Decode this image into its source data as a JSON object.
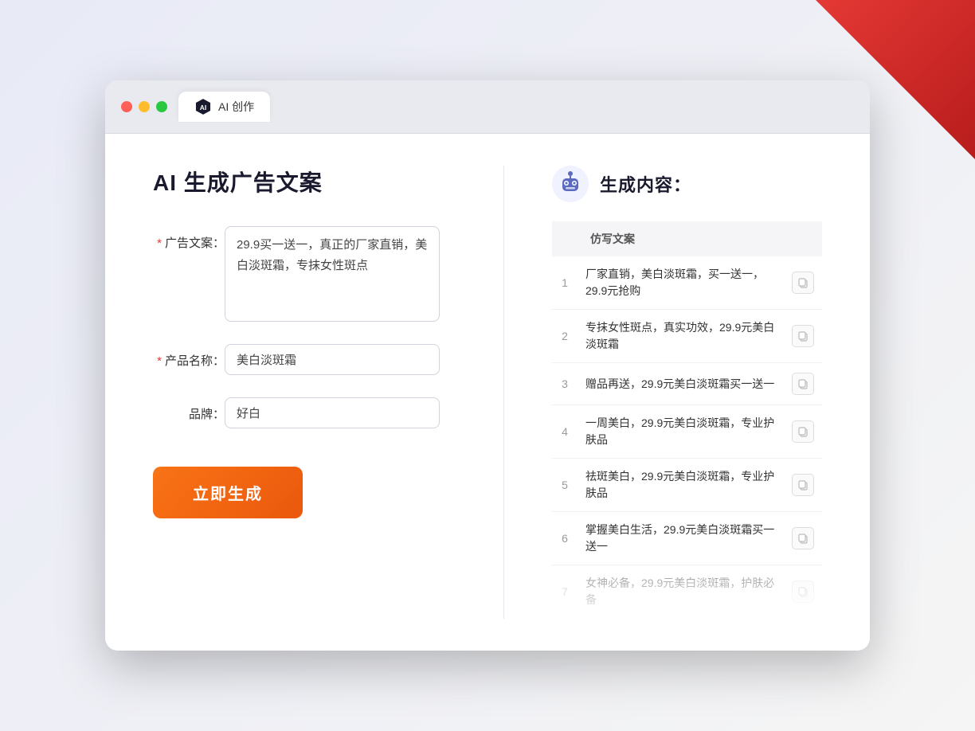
{
  "decorations": {
    "corner": "red-triangle"
  },
  "titlebar": {
    "tab_label": "AI 创作",
    "traffic_lights": [
      "red",
      "yellow",
      "green"
    ]
  },
  "left_panel": {
    "title": "AI 生成广告文案",
    "form": {
      "ad_copy_label": "广告文案：",
      "ad_copy_required": "*",
      "ad_copy_value": "29.9买一送一，真正的厂家直销，美白淡斑霜，专抹女性斑点",
      "product_name_label": "产品名称：",
      "product_name_required": "*",
      "product_name_value": "美白淡斑霜",
      "brand_label": "品牌：",
      "brand_value": "好白"
    },
    "generate_button": "立即生成"
  },
  "right_panel": {
    "title": "生成内容：",
    "table_header": "仿写文案",
    "items": [
      {
        "num": "1",
        "text": "厂家直销，美白淡斑霜，买一送一，29.9元抢购"
      },
      {
        "num": "2",
        "text": "专抹女性斑点，真实功效，29.9元美白淡斑霜"
      },
      {
        "num": "3",
        "text": "赠品再送，29.9元美白淡斑霜买一送一"
      },
      {
        "num": "4",
        "text": "一周美白，29.9元美白淡斑霜，专业护肤品"
      },
      {
        "num": "5",
        "text": "祛斑美白，29.9元美白淡斑霜，专业护肤品"
      },
      {
        "num": "6",
        "text": "掌握美白生活，29.9元美白淡斑霜买一送一"
      },
      {
        "num": "7",
        "text": "女神必备，29.9元美白淡斑霜，护肤必备",
        "faded": true
      }
    ]
  }
}
